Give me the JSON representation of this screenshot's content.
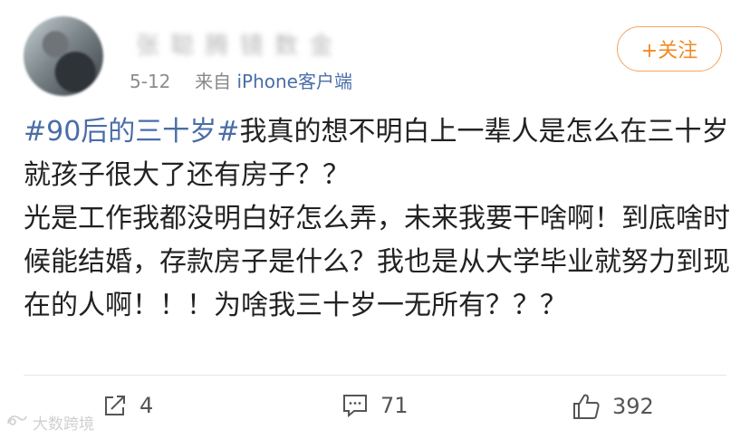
{
  "post": {
    "author_name": "张 聪 腾 镜 数 金",
    "date": "5-12",
    "source_prefix": "来自",
    "device": "iPhone客户端",
    "follow_label": "+关注",
    "topic": "#90后的三十岁#",
    "body_line1": "我真的想不明白上一辈人是怎么在三十岁就孩子很大了还有房子？？",
    "body_line2": "光是工作我都没明白好怎么弄，未来我要干啥啊！到底啥时候能结婚，存款房子是什么？我也是从大学毕业就努力到现在的人啊！！！为啥我三十岁一无所有？？？"
  },
  "actions": {
    "repost_count": "4",
    "comment_count": "71",
    "like_count": "392"
  },
  "watermark": {
    "text": "大数跨境"
  }
}
